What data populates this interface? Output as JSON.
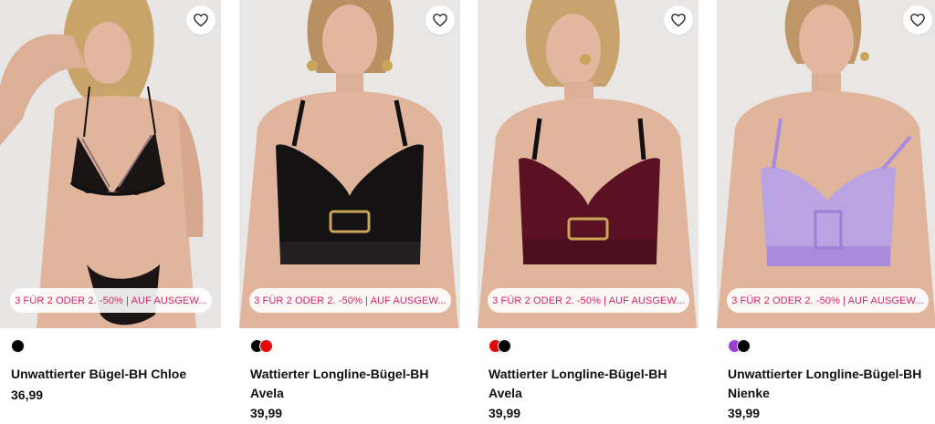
{
  "products": [
    {
      "name": "Unwattierter Bügel-BH Chloe",
      "price": "36,99",
      "promo": "3 FÜR 2 ODER 2. -50% | AUF AUSGEW...",
      "colors": [
        "#000000"
      ],
      "image_icon": "product-photo-black-lace-bra"
    },
    {
      "name": "Wattierter Longline-Bügel-BH Avela",
      "price": "39,99",
      "promo": "3 FÜR 2 ODER 2. -50% | AUF AUSGEW...",
      "colors": [
        "#000000",
        "#e10b0b"
      ],
      "image_icon": "product-photo-black-satin-bra"
    },
    {
      "name": "Wattierter Longline-Bügel-BH Avela",
      "price": "39,99",
      "promo": "3 FÜR 2 ODER 2. -50% | AUF AUSGEW...",
      "colors": [
        "#e10b0b",
        "#000000"
      ],
      "image_icon": "product-photo-burgundy-satin-bra"
    },
    {
      "name": "Unwattierter Longline-Bügel-BH Nienke",
      "price": "39,99",
      "promo": "3 FÜR 2 ODER 2. -50% | AUF AUSGEW...",
      "colors": [
        "#9b3fd6",
        "#000000"
      ],
      "image_icon": "product-photo-lilac-lace-bra"
    }
  ],
  "icons": {
    "wishlist": "heart-outline-icon"
  },
  "theme": {
    "promo_text": "#d61f69",
    "skin": "#e0b59c",
    "background": "#e9e7e6"
  }
}
